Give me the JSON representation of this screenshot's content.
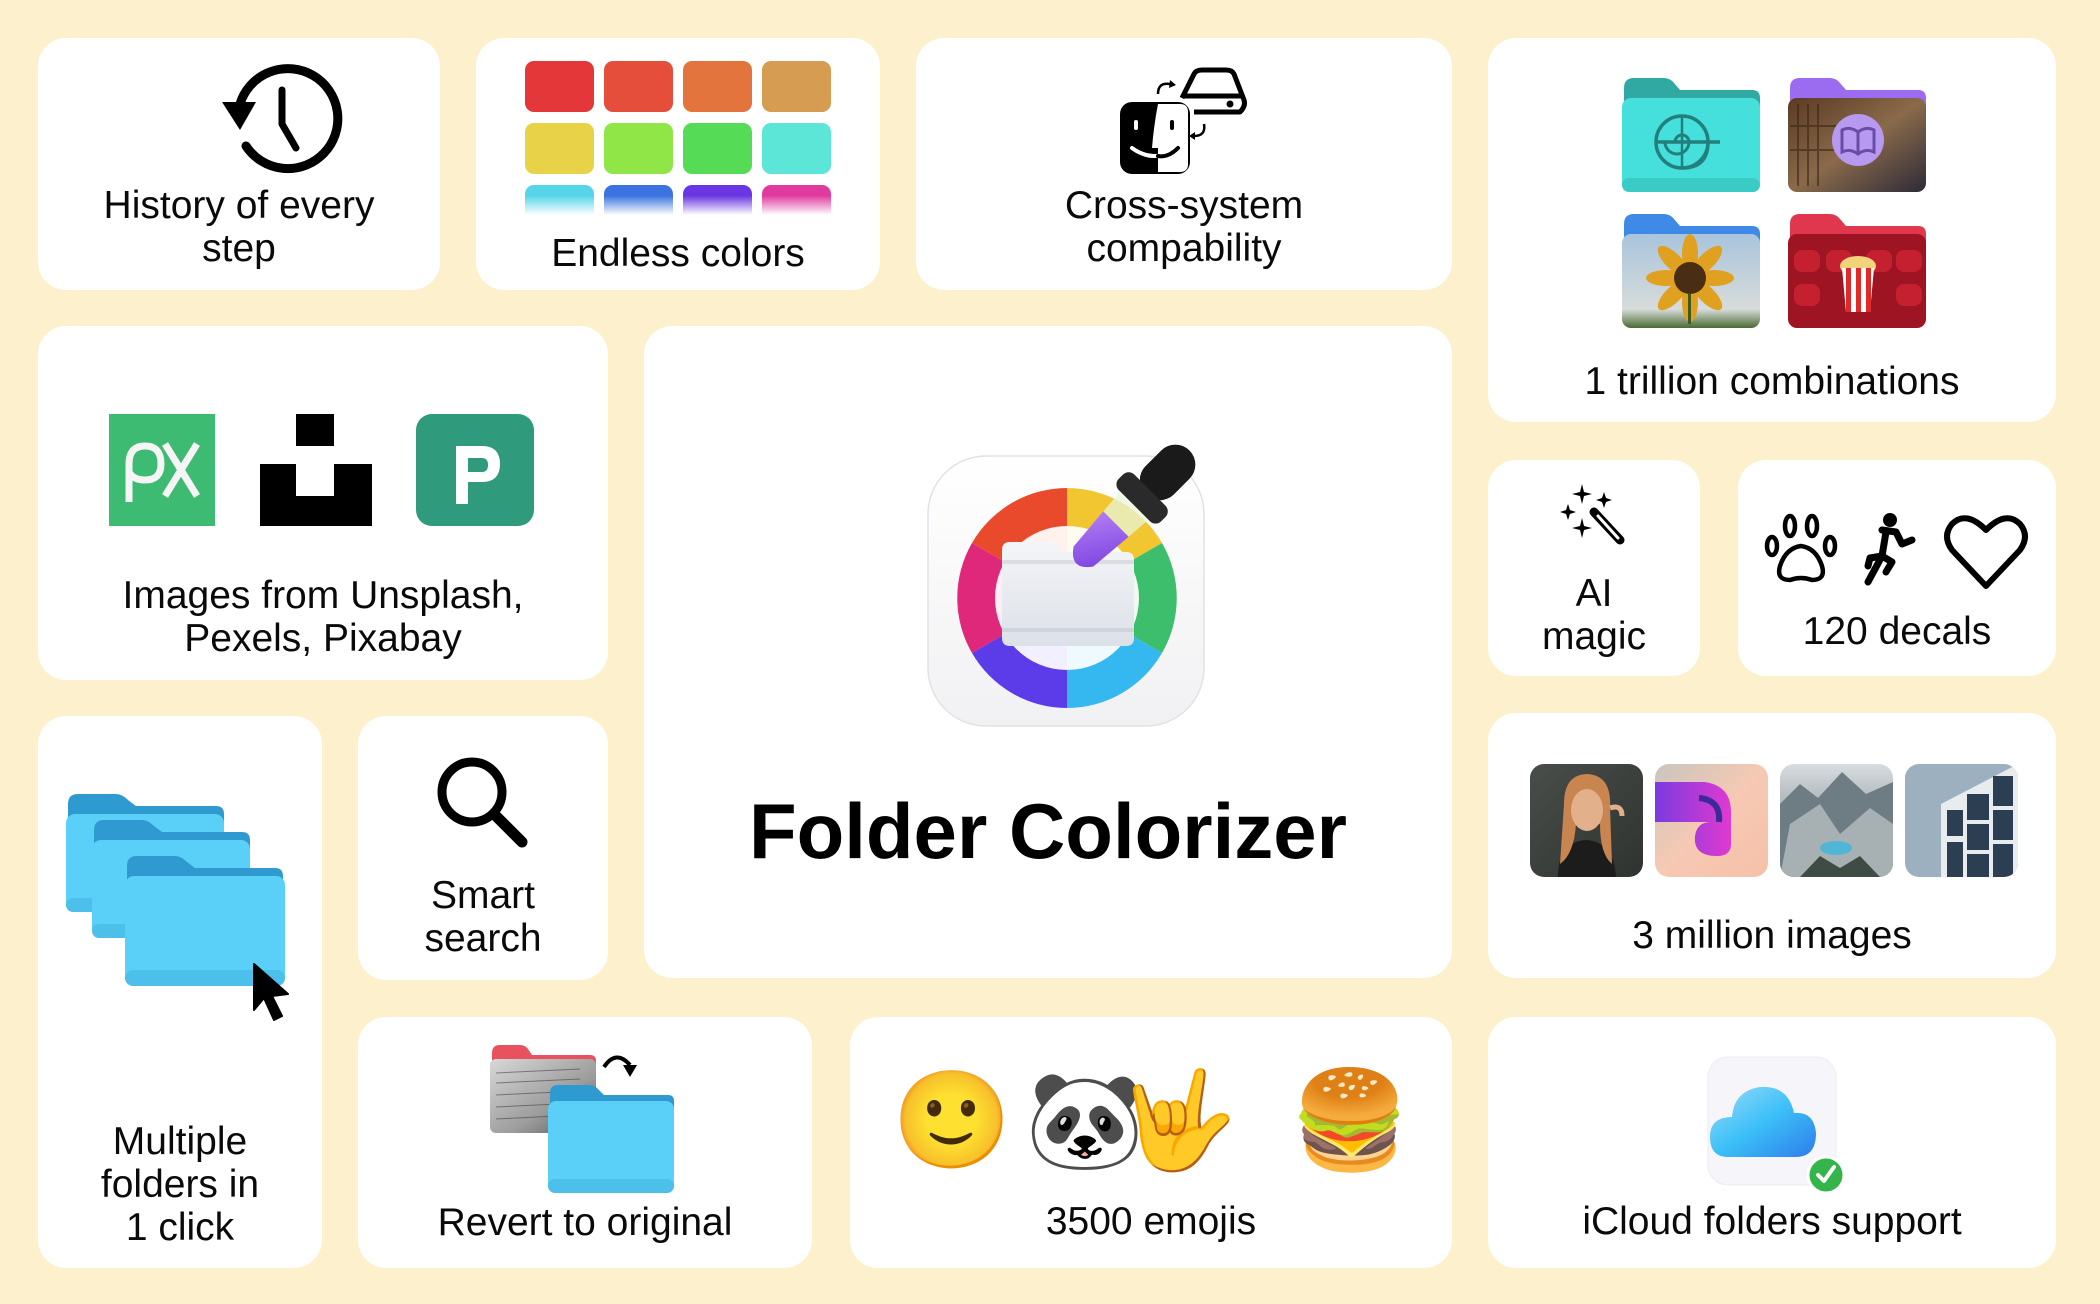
{
  "background_color": "#FDF0CD",
  "app": {
    "name": "Folder Colorizer",
    "icon": "folder-colorizer-app-icon"
  },
  "features": {
    "history": {
      "label_line1": "History of every",
      "label_line2": "step",
      "icon": "history-clock-icon"
    },
    "colors": {
      "label": "Endless colors",
      "icon": "color-swatches",
      "swatches": [
        "#E4373A",
        "#E44E3B",
        "#E4743E",
        "#D59C52",
        "#E8D348",
        "#8FE646",
        "#55DB55",
        "#5CE6D8",
        "#55D4EA",
        "#3B73E0",
        "#6A35E3",
        "#E03A9E"
      ]
    },
    "cross_system": {
      "label_line1": "Cross-system",
      "label_line2": "compability",
      "icon": "finder-drive-swap-icon"
    },
    "combinations": {
      "label": "1 trillion combinations",
      "folders": [
        {
          "name": "teal-folder-nautilus",
          "color": "#45E0DC"
        },
        {
          "name": "purple-folder-library-book",
          "color": "#9B6CF0"
        },
        {
          "name": "blue-folder-sunflower",
          "color": "#3E8AE6"
        },
        {
          "name": "red-folder-cinema-popcorn",
          "color": "#E0364E"
        }
      ]
    },
    "image_sources": {
      "label_line1": "Images from Unsplash,",
      "label_line2": "Pexels, Pixabay",
      "logos": [
        {
          "name": "pixabay-logo",
          "text": "px",
          "color": "#3DBB72"
        },
        {
          "name": "unsplash-logo",
          "color": "#000000"
        },
        {
          "name": "pexels-logo",
          "color": "#2F9A7C"
        }
      ]
    },
    "ai_magic": {
      "label_line1": "AI",
      "label_line2": "magic",
      "icon": "magic-wand-sparkles-icon"
    },
    "decals": {
      "label": "120 decals",
      "icons": [
        "paw-icon",
        "running-person-icon",
        "heart-icon"
      ]
    },
    "million_images": {
      "label": "3 million images",
      "thumbnails": [
        "portrait-woman",
        "abstract-3d-purple",
        "mountain-lake",
        "building-facade"
      ]
    },
    "multiple_folders": {
      "label_line1": "Multiple",
      "label_line2": "folders in",
      "label_line3": "1 click",
      "icon": "stacked-folders-cursor-icon"
    },
    "smart_search": {
      "label_line1": "Smart",
      "label_line2": "search",
      "icon": "magnifier-icon"
    },
    "revert": {
      "label": "Revert to original",
      "icon": "revert-folder-icon"
    },
    "emojis": {
      "label": "3500 emojis",
      "items": [
        "🙂",
        "🐼",
        "🤟",
        "🍔"
      ]
    },
    "icloud": {
      "label": "iCloud folders support",
      "icon": "icloud-check-icon"
    }
  }
}
